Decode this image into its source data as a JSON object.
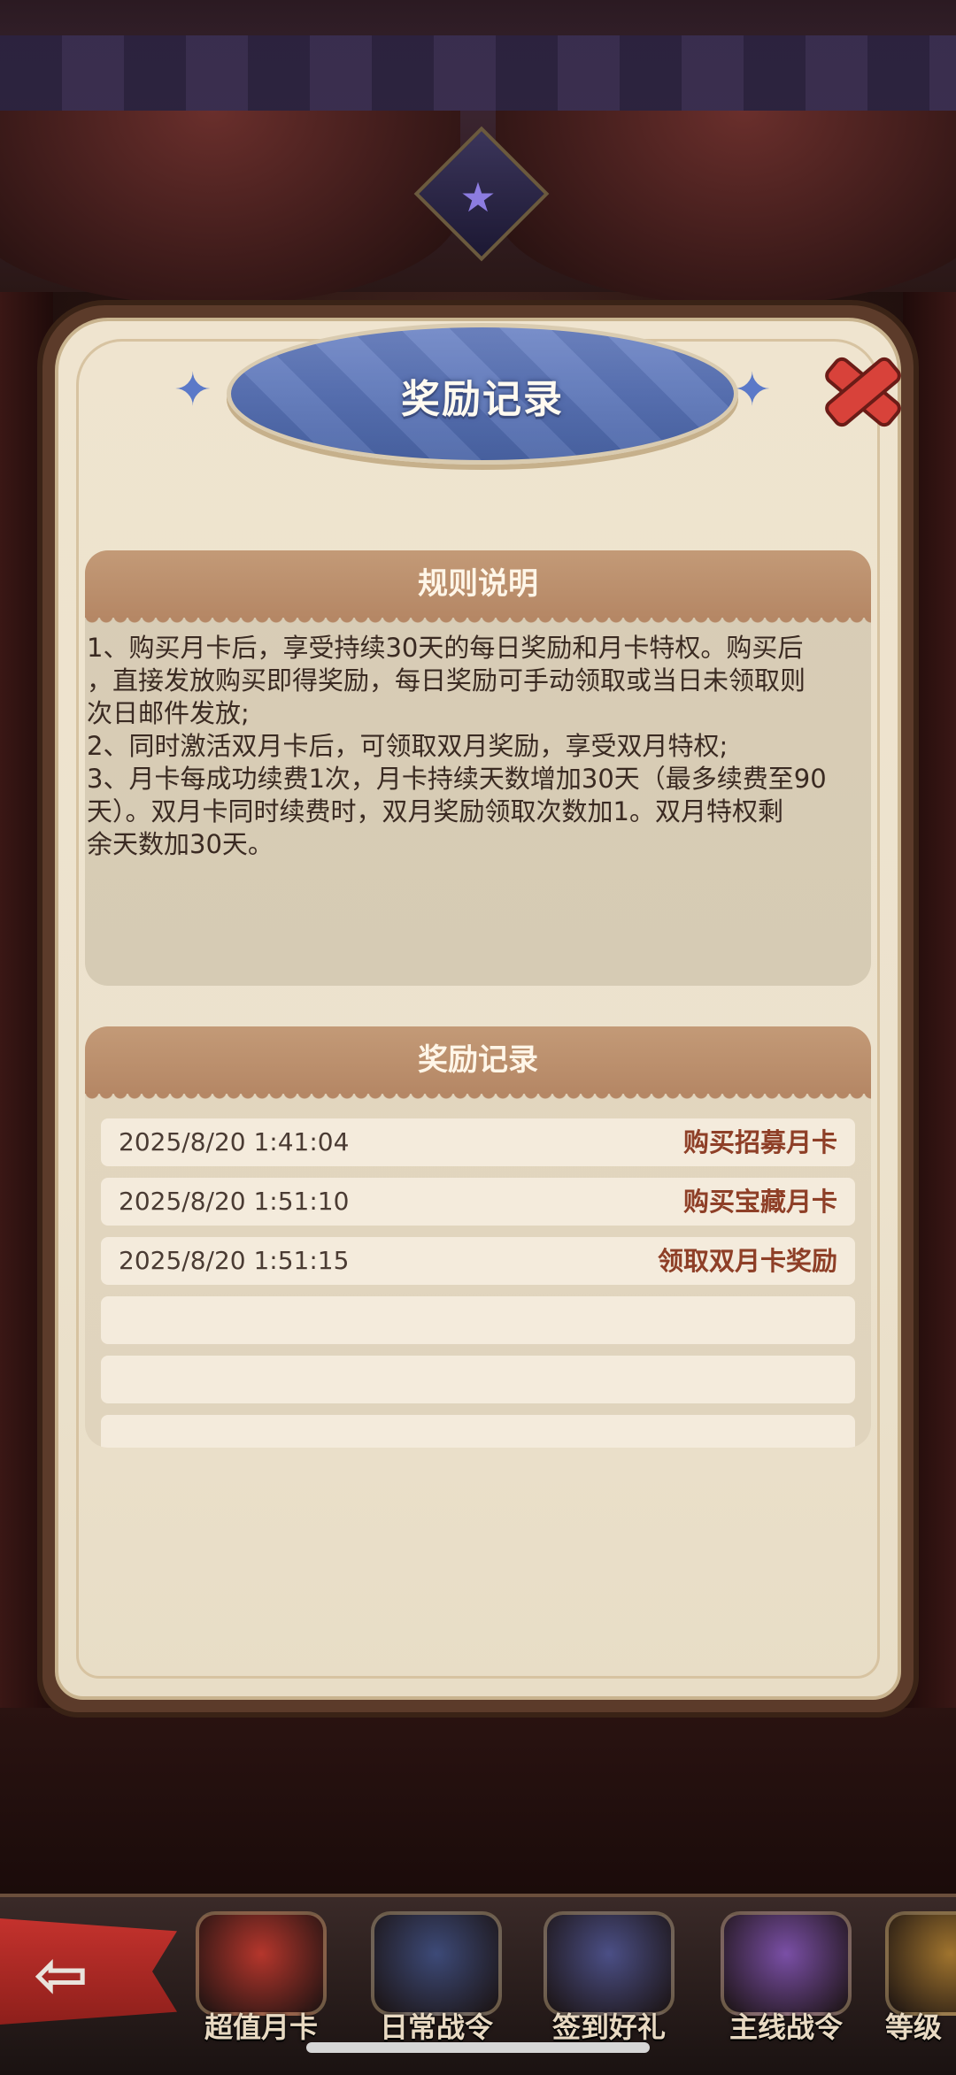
{
  "dialog": {
    "title": "奖励记录",
    "close_icon": "close-x-icon"
  },
  "rules": {
    "header": "规则说明",
    "lines": [
      "1、购买月卡后，享受持续30天的每日奖励和月卡特权。购买后",
      "，直接发放购买即得奖励，每日奖励可手动领取或当日未领取则",
      "次日邮件发放;",
      "2、同时激活双月卡后，可领取双月奖励，享受双月特权;",
      "3、月卡每成功续费1次，月卡持续天数增加30天（最多续费至90",
      "天）。双月卡同时续费时，双月奖励领取次数加1。双月特权剩",
      "余天数加30天。"
    ]
  },
  "records": {
    "header": "奖励记录",
    "rows": [
      {
        "date": "2025/8/20  1:41:04",
        "action": "购买招募月卡"
      },
      {
        "date": "2025/8/20  1:51:10",
        "action": "购买宝藏月卡"
      },
      {
        "date": "2025/8/20  1:51:15",
        "action": "领取双月卡奖励"
      },
      {
        "date": "",
        "action": ""
      },
      {
        "date": "",
        "action": ""
      },
      {
        "date": "",
        "action": ""
      }
    ]
  },
  "bottom_nav": {
    "back_icon": "back-arrow-icon",
    "items": [
      {
        "label": "超值月卡",
        "icon": "coupon-icon",
        "color": "#b5362c"
      },
      {
        "label": "日常战令",
        "icon": "sword-badge-icon",
        "color": "#3d4a78"
      },
      {
        "label": "签到好礼",
        "icon": "calendar-icon",
        "color": "#4b4f86"
      },
      {
        "label": "主线战令",
        "icon": "crown-icon",
        "color": "#7a4fa6"
      },
      {
        "label": "等级",
        "icon": "level-icon",
        "color": "#a0742e"
      }
    ]
  }
}
